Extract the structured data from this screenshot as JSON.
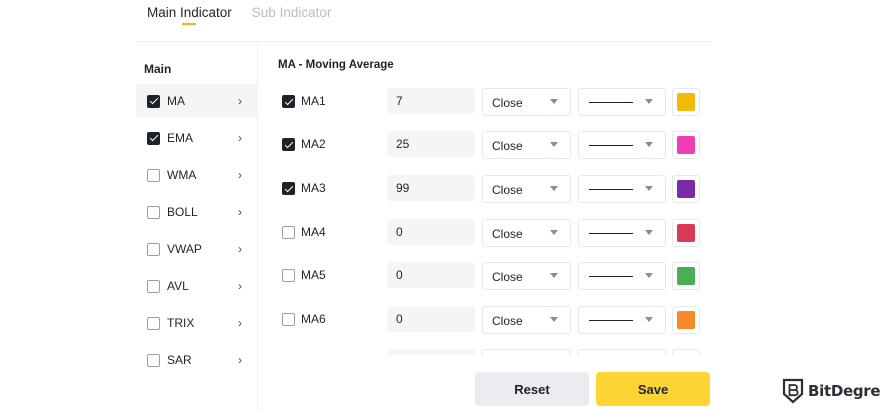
{
  "tabs": [
    {
      "label": "Main Indicator",
      "active": true
    },
    {
      "label": "Sub Indicator",
      "active": false
    }
  ],
  "sidebar": {
    "title": "Main",
    "items": [
      {
        "label": "MA",
        "checked": true,
        "active": true,
        "chevron_icon": "chevron-right-icon"
      },
      {
        "label": "EMA",
        "checked": true,
        "active": false,
        "chevron_icon": "chevron-right-icon"
      },
      {
        "label": "WMA",
        "checked": false,
        "active": false,
        "chevron_icon": "chevron-right-icon"
      },
      {
        "label": "BOLL",
        "checked": false,
        "active": false,
        "chevron_icon": "chevron-right-icon"
      },
      {
        "label": "VWAP",
        "checked": false,
        "active": false,
        "chevron_icon": "chevron-right-icon"
      },
      {
        "label": "AVL",
        "checked": false,
        "active": false,
        "chevron_icon": "chevron-right-icon"
      },
      {
        "label": "TRIX",
        "checked": false,
        "active": false,
        "chevron_icon": "chevron-right-icon"
      },
      {
        "label": "SAR",
        "checked": false,
        "active": false,
        "chevron_icon": "chevron-right-icon"
      }
    ]
  },
  "panel": {
    "title": "MA - Moving Average",
    "rows": [
      {
        "label": "MA1",
        "checked": true,
        "value": "7",
        "source": "Close",
        "color": "#f0b90b"
      },
      {
        "label": "MA2",
        "checked": true,
        "value": "25",
        "source": "Close",
        "color": "#ee3fb4"
      },
      {
        "label": "MA3",
        "checked": true,
        "value": "99",
        "source": "Close",
        "color": "#7a2ca8"
      },
      {
        "label": "MA4",
        "checked": false,
        "value": "0",
        "source": "Close",
        "color": "#d83a5c"
      },
      {
        "label": "MA5",
        "checked": false,
        "value": "0",
        "source": "Close",
        "color": "#4cae54"
      },
      {
        "label": "MA6",
        "checked": false,
        "value": "0",
        "source": "Close",
        "color": "#f58a2a"
      }
    ]
  },
  "footer": {
    "reset_label": "Reset",
    "save_label": "Save"
  },
  "brand": {
    "name": "BitDegree",
    "icon": "bitdegree-shield-icon"
  },
  "colors": {
    "accent": "#f0b90b",
    "save_button": "#fcd535",
    "reset_button": "#eaecef"
  }
}
